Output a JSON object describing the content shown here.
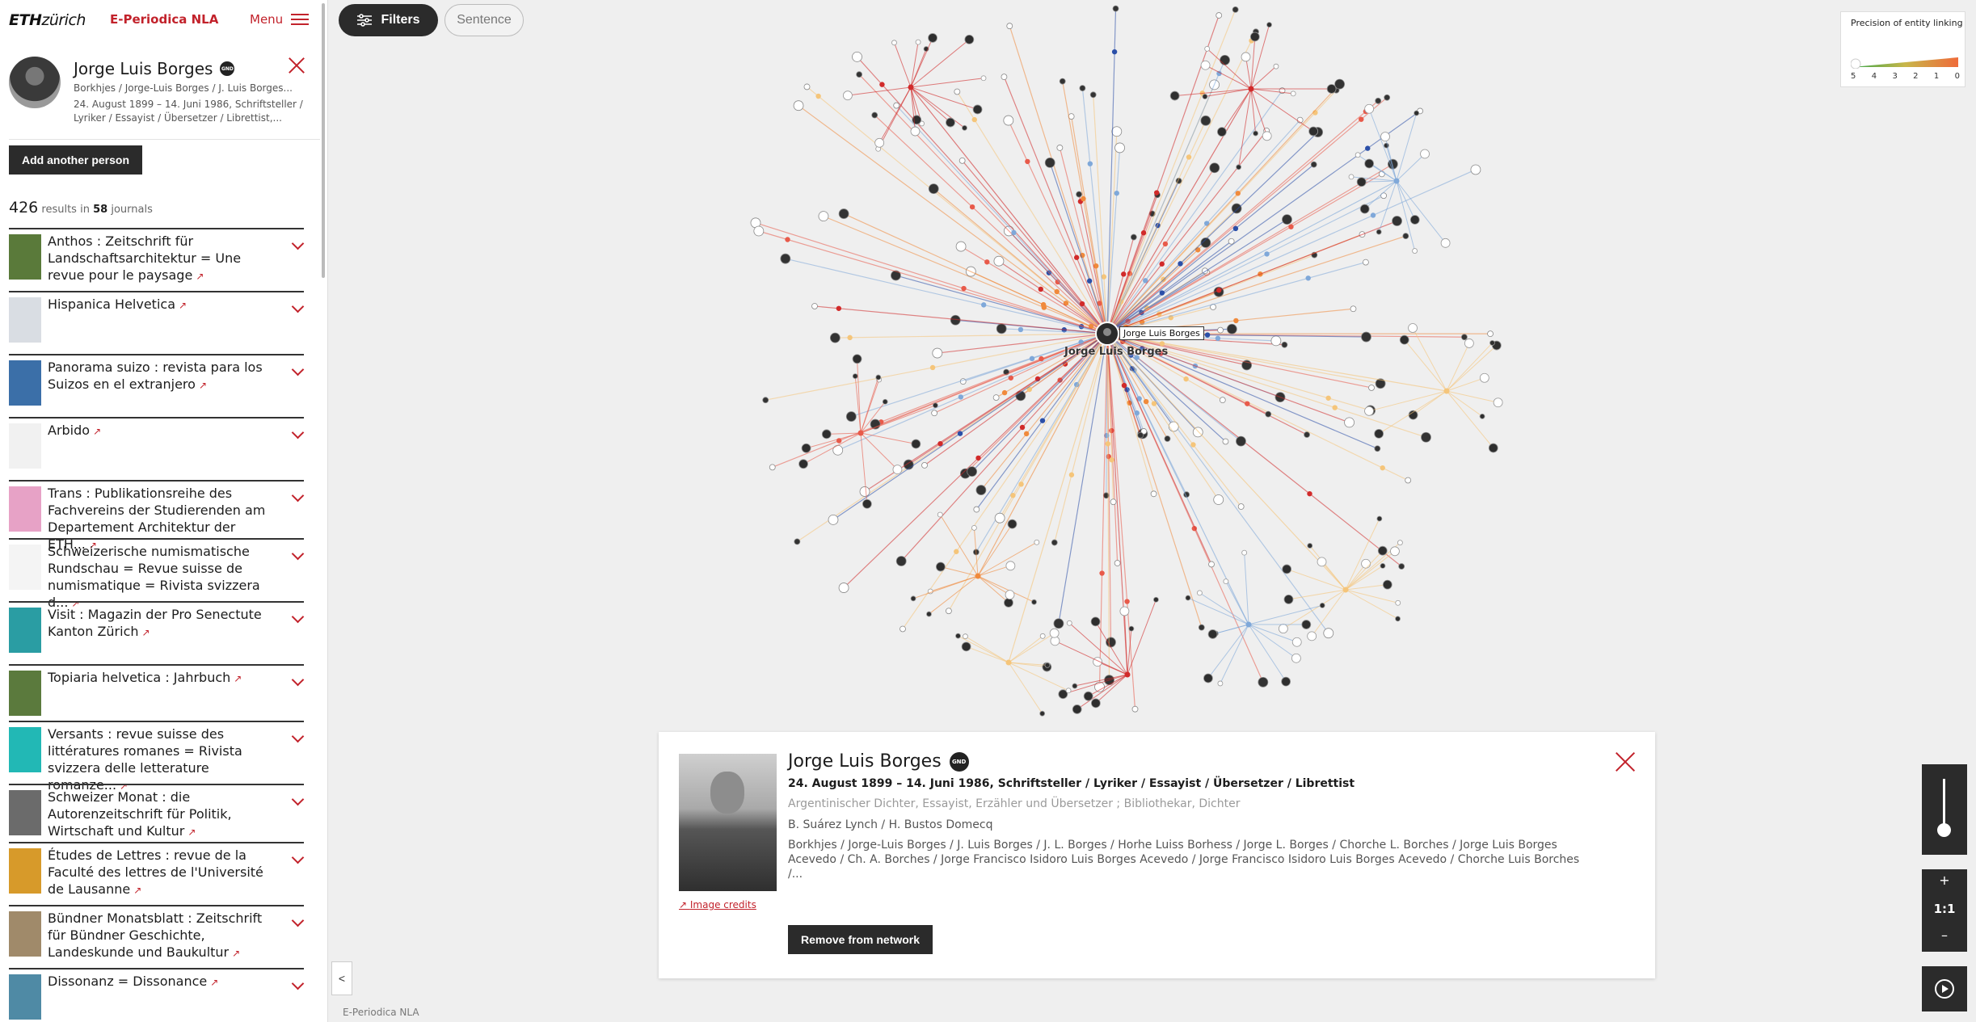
{
  "header": {
    "logo_eth": "ETH",
    "logo_zurich": "zürich",
    "app_name": "E-Periodica NLA",
    "menu_label": "Menu"
  },
  "person": {
    "name": "Jorge Luis Borges",
    "gnd_badge": "GND",
    "aliases": "Borkhjes / Jorge-Luis Borges / J. Luis Borges...",
    "dates_roles": "24. August 1899 – 14. Juni 1986, Schriftsteller / Lyriker / Essayist / Übersetzer / Librettist,...",
    "add_button": "Add another person"
  },
  "results": {
    "count": "426",
    "results_in": "results in",
    "journals_count": "58",
    "journals_word": "journals"
  },
  "journals": [
    {
      "title": "Anthos : Zeitschrift für Landschaftsarchitektur = Une revue pour le paysage",
      "thumb_color": "#5a7a3a"
    },
    {
      "title": "Hispanica Helvetica",
      "thumb_color": "#d9dde3"
    },
    {
      "title": "Panorama suizo : revista para los Suizos en el extranjero",
      "thumb_color": "#3b6fa8"
    },
    {
      "title": "Arbido",
      "thumb_color": "#f1f1f1"
    },
    {
      "title": "Trans : Publikationsreihe des Fachvereins der Studierenden am Departement Architektur der ETH...",
      "thumb_color": "#e7a2c6"
    },
    {
      "title": "Schweizerische numismatische Rundschau = Revue suisse de numismatique = Rivista svizzera d...",
      "thumb_color": "#f4f4f4"
    },
    {
      "title": "Visit : Magazin der Pro Senectute Kanton Zürich",
      "thumb_color": "#2a9da3"
    },
    {
      "title": "Topiaria helvetica : Jahrbuch",
      "thumb_color": "#5b7a3d"
    },
    {
      "title": "Versants : revue suisse des littératures romanes = Rivista svizzera delle letterature romanze...",
      "thumb_color": "#22b8b5"
    },
    {
      "title": "Schweizer Monat : die Autorenzeitschrift für Politik, Wirtschaft und Kultur",
      "thumb_color": "#6b6b6b"
    },
    {
      "title": "Études de Lettres : revue de la Faculté des lettres de l'Université de Lausanne",
      "thumb_color": "#d79a2a"
    },
    {
      "title": "Bündner Monatsblatt : Zeitschrift für Bündner Geschichte, Landeskunde und Baukultur",
      "thumb_color": "#a08a6a"
    },
    {
      "title": "Dissonanz = Dissonance",
      "thumb_color": "#4f8aa5"
    }
  ],
  "toolbar": {
    "filters_label": "Filters",
    "sentence_label": "Sentence"
  },
  "legend": {
    "title": "Precision of entity linking",
    "ticks": [
      "5",
      "4",
      "3",
      "2",
      "1",
      "0"
    ]
  },
  "network": {
    "center_tag": "Jorge Luis Borges",
    "center_label": "Jorge Luis Borges",
    "colors": [
      "#d12a2a",
      "#f08a3c",
      "#2b4fa8",
      "#7fa8d9",
      "#f5c57a",
      "#e85a4a"
    ]
  },
  "controls": {
    "zoom_in": "+",
    "zoom_level": "1:1",
    "zoom_out": "–",
    "collapse": "<"
  },
  "footer": {
    "label": "E-Periodica NLA"
  },
  "card": {
    "name": "Jorge Luis Borges",
    "gnd_badge": "GND",
    "life": "24. August 1899 – 14. Juni 1986, Schriftsteller / Lyriker / Essayist / Übersetzer / Librettist",
    "description": "Argentinischer Dichter, Essayist, Erzähler und Übersetzer ; Bibliothekar, Dichter",
    "pseudonyms": "B. Suárez Lynch / H. Bustos Domecq",
    "aliases": "Borkhjes / Jorge-Luis Borges / J. Luis Borges / J. L. Borges / Horhe Luiss Borhess / Jorge L. Borges / Chorche L. Borches / Jorge Luis Borges Acevedo / Ch. A. Borches / Jorge Francisco Isidoro Luis Borges Acevedo / Jorge Francisco Isidoro Luis Borges Acevedo / Chorche Luis Borches /...",
    "credits": "Image credits",
    "remove_button": "Remove from network"
  }
}
